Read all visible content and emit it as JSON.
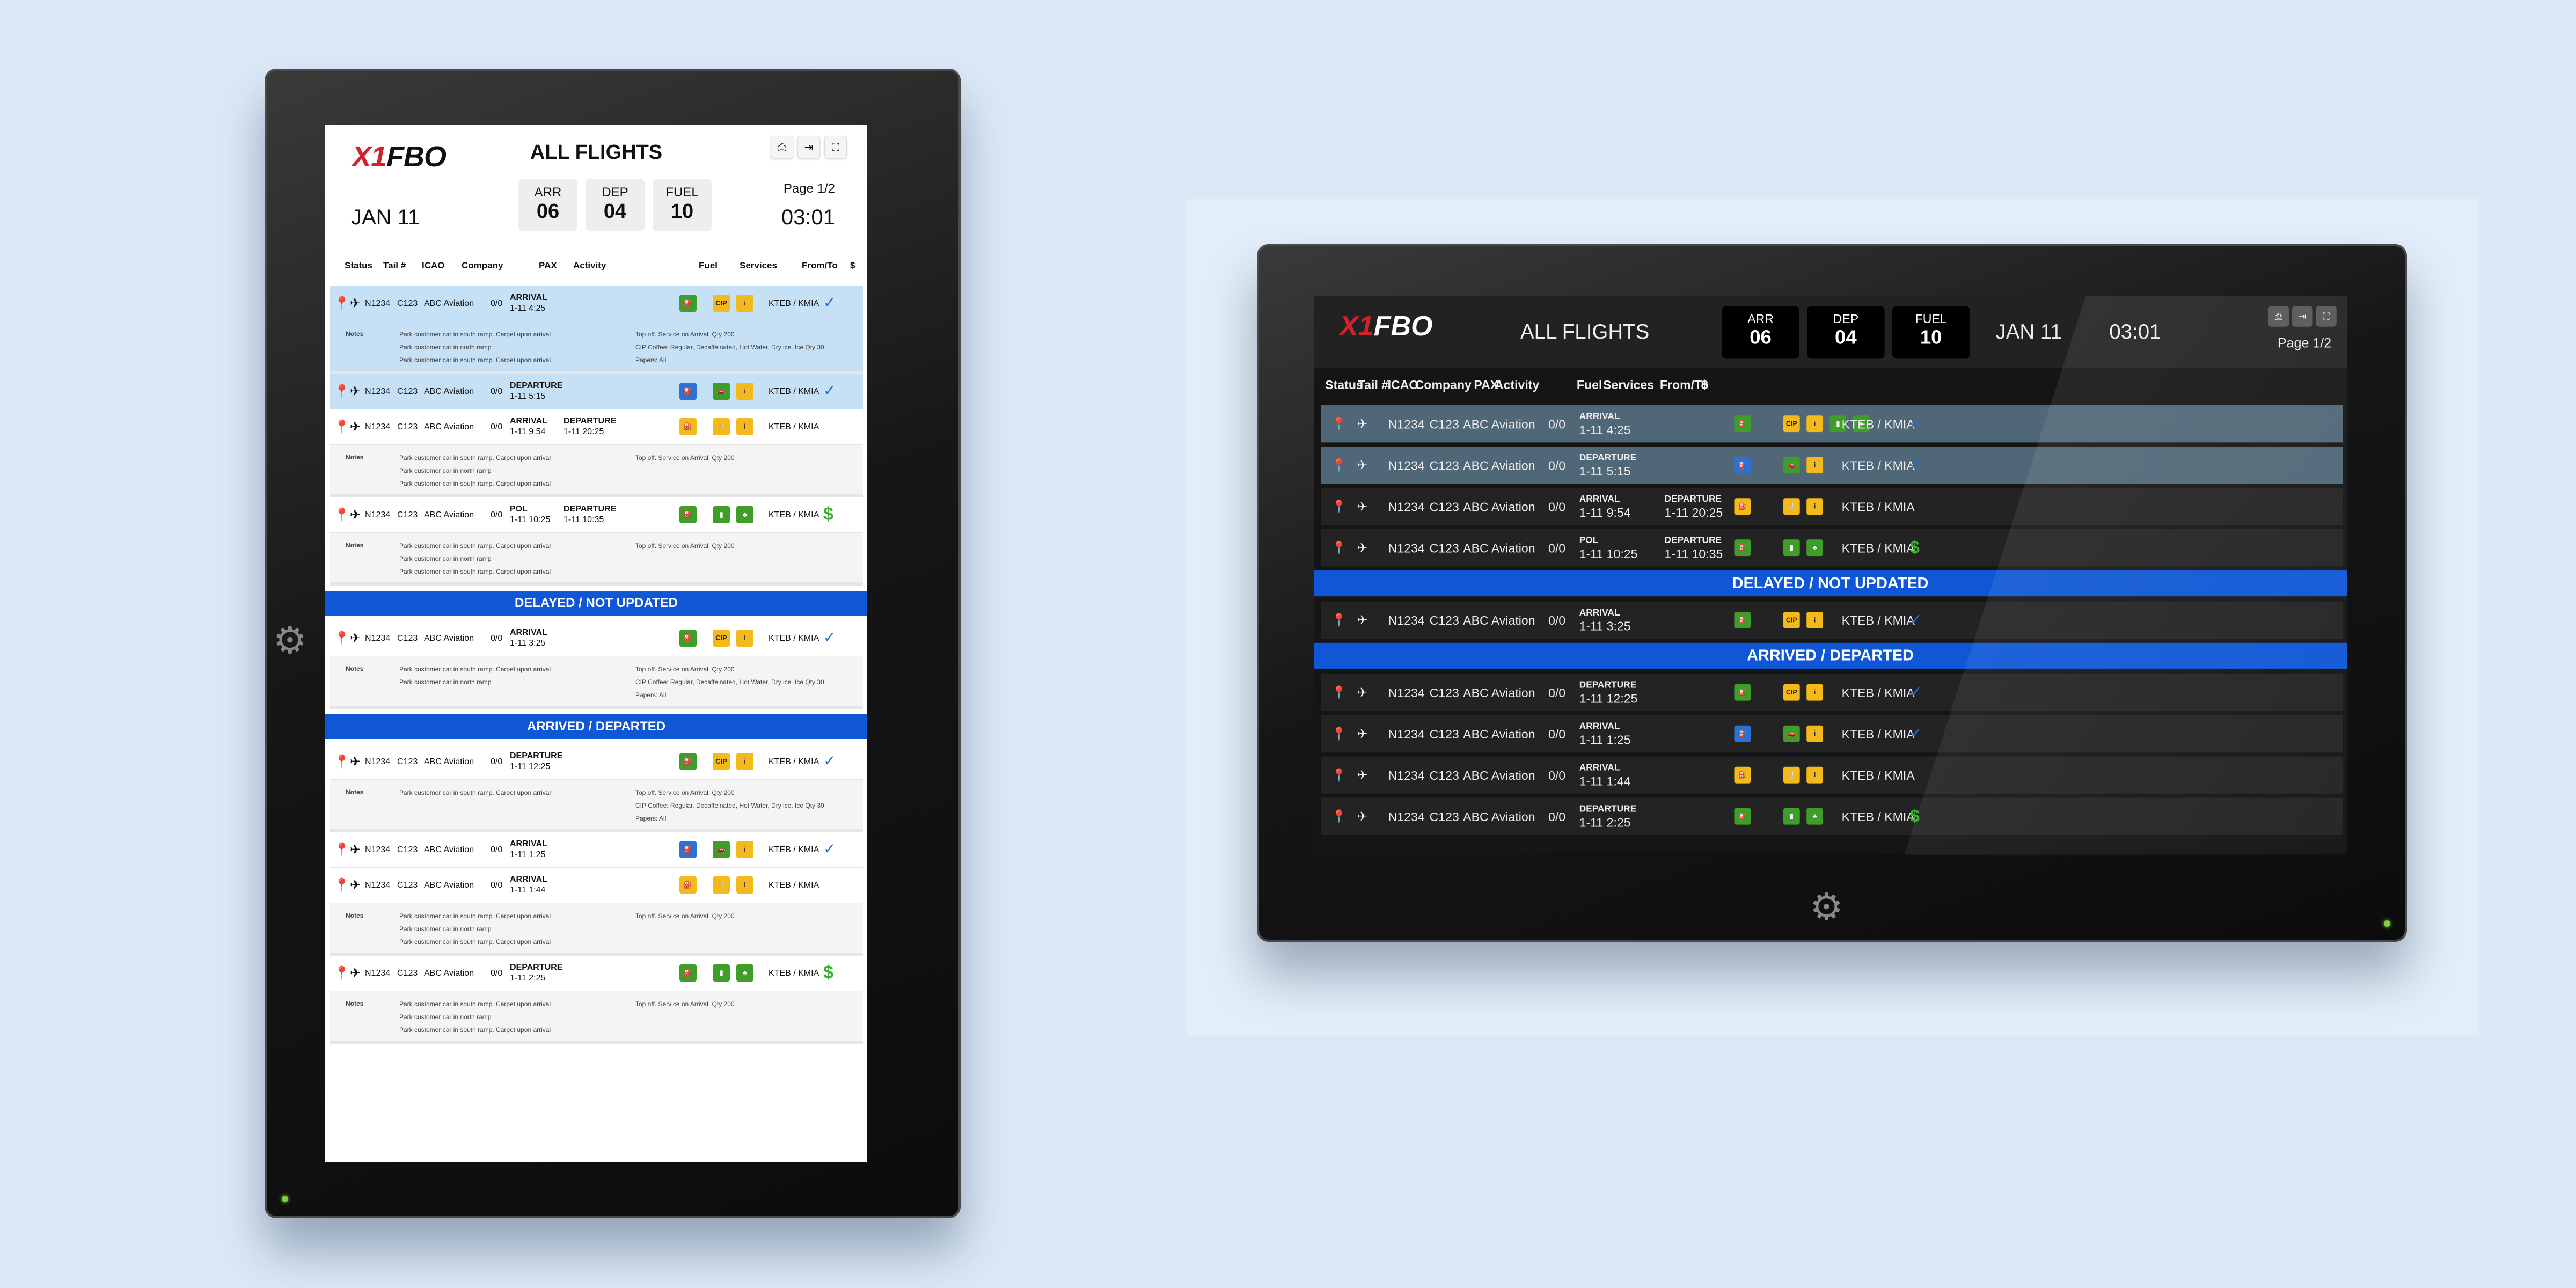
{
  "app": {
    "logo_accent": "X1",
    "logo_text": "FBO",
    "title": "ALL FLIGHTS",
    "date": "JAN 11",
    "time": "03:01",
    "page": "Page 1/2"
  },
  "stats": [
    {
      "label": "ARR",
      "value": "06"
    },
    {
      "label": "DEP",
      "value": "04"
    },
    {
      "label": "FUEL",
      "value": "10"
    }
  ],
  "toolbar": {
    "print_icon": "printer-icon",
    "export_icon": "export-icon",
    "fullscreen_icon": "fullscreen-icon"
  },
  "columns": [
    "Status",
    "Tail #",
    "ICAO",
    "Company",
    "PAX",
    "Activity",
    "Fuel",
    "Services",
    "From/To",
    "$"
  ],
  "bands": {
    "delayed": "DELAYED / NOT UPDATED",
    "arrived": "ARRIVED / DEPARTED"
  },
  "labels": {
    "notes": "Notes"
  },
  "portrait_rows": [
    {
      "tail": "N1234",
      "icao": "C123",
      "company": "ABC Aviation",
      "pax": "0/0",
      "a1": "ARRIVAL",
      "t1": "1-11 4:25",
      "a2": "",
      "t2": "",
      "route": "KTEB / KMIA",
      "pay": "check",
      "fuel": "g",
      "svc": [
        "CIP",
        "i"
      ],
      "hl": true,
      "notes": [
        "Park customer car in south ramp. Carpet upon arrival",
        "Park customer car in north ramp",
        "Park customer car in south ramp. Carpet upon arrival"
      ],
      "svcnotes": [
        "Top off. Service on Arrival. Qty 200",
        "CIP  Coffee: Regular, Decaffeinated, Hot Water, Dry ice. Ice Qty 30",
        "Papers: All"
      ]
    },
    {
      "tail": "N1234",
      "icao": "C123",
      "company": "ABC Aviation",
      "pax": "0/0",
      "a1": "DEPARTURE",
      "t1": "1-11 5:15",
      "a2": "",
      "t2": "",
      "route": "KTEB / KMIA",
      "pay": "check",
      "fuel": "b",
      "svc": [
        "car",
        "i"
      ],
      "hl": true
    },
    {
      "tail": "N1234",
      "icao": "C123",
      "company": "ABC Aviation",
      "pax": "0/0",
      "a1": "ARRIVAL",
      "t1": "1-11 9:54",
      "a2": "DEPARTURE",
      "t2": "1-11 20:25",
      "route": "KTEB / KMIA",
      "pay": "",
      "fuel": "y",
      "svc": [
        "cat",
        "i"
      ],
      "notes": [
        "Park customer car in south ramp. Carpet upon arrival",
        "Park customer car in north ramp",
        "Park customer car in south ramp. Carpet upon arrival"
      ],
      "svcnotes": [
        "Top off. Service on Arrival. Qty 200"
      ]
    },
    {
      "tail": "N1234",
      "icao": "C123",
      "company": "ABC Aviation",
      "pax": "0/0",
      "a1": "POL",
      "t1": "1-11 10:25",
      "a2": "DEPARTURE",
      "t2": "1-11 10:35",
      "route": "KTEB / KMIA",
      "pay": "$",
      "fuel": "g",
      "svc": [
        "gpu",
        "lav"
      ],
      "notes": [
        "Park customer car in south ramp. Carpet upon arrival",
        "Park customer car in north ramp",
        "Park customer car in south ramp. Carpet upon arrival"
      ],
      "svcnotes": [
        "Top off. Service on Arrival. Qty 200"
      ]
    }
  ],
  "portrait_delayed": [
    {
      "tail": "N1234",
      "icao": "C123",
      "company": "ABC Aviation",
      "pax": "0/0",
      "a1": "ARRIVAL",
      "t1": "1-11 3:25",
      "route": "KTEB / KMIA",
      "pay": "check",
      "fuel": "g",
      "svc": [
        "CIP",
        "i"
      ],
      "notes": [
        "Park customer car in south ramp. Carpet upon arrival",
        "Park customer car in north ramp"
      ],
      "svcnotes": [
        "Top off. Service on Arrival. Qty 200",
        "CIP  Coffee: Regular, Decaffeinated, Hot Water, Dry ice. Ice Qty 30",
        "Papers: All"
      ]
    }
  ],
  "portrait_arrived": [
    {
      "tail": "N1234",
      "icao": "C123",
      "company": "ABC Aviation",
      "pax": "0/0",
      "a1": "DEPARTURE",
      "t1": "1-11 12:25",
      "route": "KTEB / KMIA",
      "pay": "check",
      "fuel": "g",
      "svc": [
        "CIP",
        "i"
      ],
      "notes": [
        "Park customer car in south ramp. Carpet upon arrival"
      ],
      "svcnotes": [
        "Top off. Service on Arrival. Qty 200",
        "CIP  Coffee: Regular, Decaffeinated, Hot Water, Dry ice. Ice Qty 30",
        "Papers: All"
      ]
    },
    {
      "tail": "N1234",
      "icao": "C123",
      "company": "ABC Aviation",
      "pax": "0/0",
      "a1": "ARRIVAL",
      "t1": "1-11 1:25",
      "route": "KTEB / KMIA",
      "pay": "check",
      "fuel": "b",
      "svc": [
        "car",
        "i"
      ]
    },
    {
      "tail": "N1234",
      "icao": "C123",
      "company": "ABC Aviation",
      "pax": "0/0",
      "a1": "ARRIVAL",
      "t1": "1-11 1:44",
      "route": "KTEB / KMIA",
      "pay": "",
      "fuel": "y",
      "svc": [
        "cat",
        "i"
      ],
      "notes": [
        "Park customer car in south ramp. Carpet upon arrival",
        "Park customer car in north ramp",
        "Park customer car in south ramp. Carpet upon arrival"
      ],
      "svcnotes": [
        "Top off. Service on Arrival. Qty 200"
      ]
    },
    {
      "tail": "N1234",
      "icao": "C123",
      "company": "ABC Aviation",
      "pax": "0/0",
      "a1": "DEPARTURE",
      "t1": "1-11 2:25",
      "route": "KTEB / KMIA",
      "pay": "$",
      "fuel": "g",
      "svc": [
        "gpu",
        "lav"
      ],
      "notes": [
        "Park customer car in south ramp. Carpet upon arrival",
        "Park customer car in north ramp",
        "Park customer car in south ramp. Carpet upon arrival"
      ],
      "svcnotes": [
        "Top off. Service on Arrival. Qty 200"
      ]
    }
  ],
  "landscape_rows": [
    {
      "tail": "N1234",
      "icao": "C123",
      "company": "ABC Aviation",
      "pax": "0/0",
      "a1": "ARRIVAL",
      "t1": "1-11 4:25",
      "a2": "",
      "t2": "",
      "route": "KTEB / KMIA",
      "pay": "check",
      "fuel": "g",
      "svc": [
        "CIP",
        "i",
        "gpu",
        "lav"
      ],
      "hl": true
    },
    {
      "tail": "N1234",
      "icao": "C123",
      "company": "ABC Aviation",
      "pax": "0/0",
      "a1": "DEPARTURE",
      "t1": "1-11 5:15",
      "a2": "",
      "t2": "",
      "route": "KTEB / KMIA",
      "pay": "check",
      "fuel": "b",
      "svc": [
        "car",
        "i"
      ],
      "hl": true
    },
    {
      "tail": "N1234",
      "icao": "C123",
      "company": "ABC Aviation",
      "pax": "0/0",
      "a1": "ARRIVAL",
      "t1": "1-11 9:54",
      "a2": "DEPARTURE",
      "t2": "1-11 20:25",
      "route": "KTEB / KMIA",
      "pay": "",
      "fuel": "y",
      "svc": [
        "cat",
        "i"
      ]
    },
    {
      "tail": "N1234",
      "icao": "C123",
      "company": "ABC Aviation",
      "pax": "0/0",
      "a1": "POL",
      "t1": "1-11 10:25",
      "a2": "DEPARTURE",
      "t2": "1-11 10:35",
      "route": "KTEB / KMIA",
      "pay": "$",
      "fuel": "g",
      "svc": [
        "gpu",
        "lav"
      ]
    }
  ],
  "landscape_delayed": [
    {
      "tail": "N1234",
      "icao": "C123",
      "company": "ABC Aviation",
      "pax": "0/0",
      "a1": "ARRIVAL",
      "t1": "1-11 3:25",
      "route": "KTEB / KMIA",
      "pay": "check",
      "fuel": "g",
      "svc": [
        "CIP",
        "i"
      ]
    }
  ],
  "landscape_arrived": [
    {
      "tail": "N1234",
      "icao": "C123",
      "company": "ABC Aviation",
      "pax": "0/0",
      "a1": "DEPARTURE",
      "t1": "1-11 12:25",
      "route": "KTEB / KMIA",
      "pay": "check",
      "fuel": "g",
      "svc": [
        "CIP",
        "i"
      ]
    },
    {
      "tail": "N1234",
      "icao": "C123",
      "company": "ABC Aviation",
      "pax": "0/0",
      "a1": "ARRIVAL",
      "t1": "1-11 1:25",
      "route": "KTEB / KMIA",
      "pay": "check",
      "fuel": "b",
      "svc": [
        "car",
        "i"
      ]
    },
    {
      "tail": "N1234",
      "icao": "C123",
      "company": "ABC Aviation",
      "pax": "0/0",
      "a1": "ARRIVAL",
      "t1": "1-11 1:44",
      "route": "KTEB / KMIA",
      "pay": "",
      "fuel": "y",
      "svc": [
        "cat",
        "i"
      ]
    },
    {
      "tail": "N1234",
      "icao": "C123",
      "company": "ABC Aviation",
      "pax": "0/0",
      "a1": "DEPARTURE",
      "t1": "1-11 2:25",
      "route": "KTEB / KMIA",
      "pay": "$",
      "fuel": "g",
      "svc": [
        "gpu",
        "lav"
      ]
    }
  ],
  "colors": {
    "band": "#0f57d6",
    "highlight_light": "#c6e0f6",
    "highlight_dark": "#4f6777",
    "fuel_green": "#3f9e2a",
    "service_yellow": "#f4b91b",
    "fuel_blue": "#2d71d6",
    "check": "#1c6fd6",
    "paid": "#3bb030"
  }
}
